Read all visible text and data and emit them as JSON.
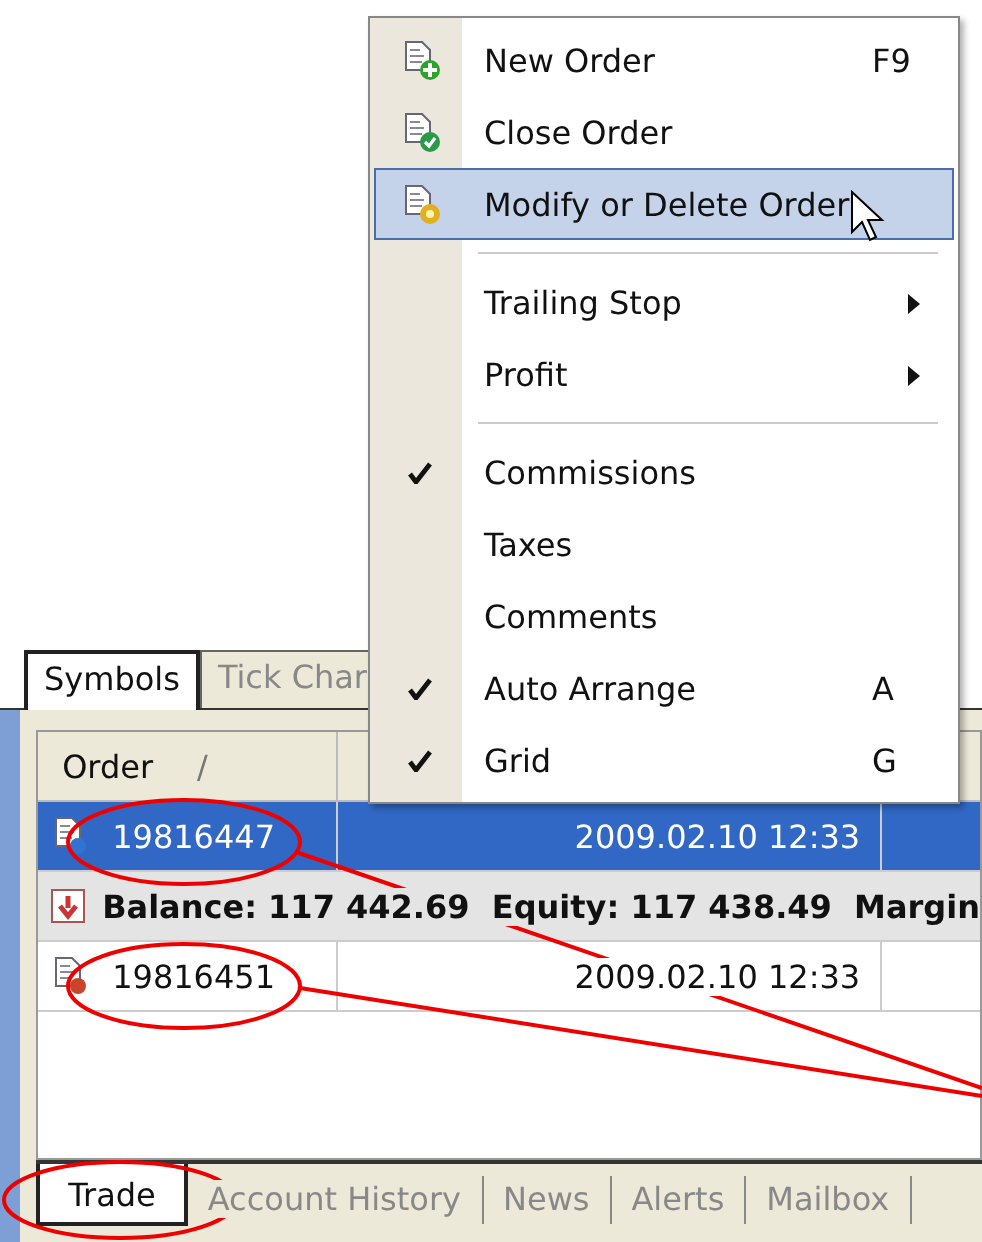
{
  "menu": {
    "items": [
      {
        "kind": "item",
        "label": "New Order",
        "shortcut": "F9",
        "highlighted": false,
        "checked": false,
        "submenu": false
      },
      {
        "kind": "item",
        "label": "Close Order",
        "highlighted": false,
        "checked": false,
        "submenu": false
      },
      {
        "kind": "item",
        "label": "Modify or Delete Order",
        "highlighted": true,
        "checked": false,
        "submenu": false
      },
      {
        "kind": "separator"
      },
      {
        "kind": "item",
        "label": "Trailing Stop",
        "highlighted": false,
        "checked": false,
        "submenu": true
      },
      {
        "kind": "item",
        "label": "Profit",
        "highlighted": false,
        "checked": false,
        "submenu": true
      },
      {
        "kind": "separator"
      },
      {
        "kind": "item",
        "label": "Commissions",
        "highlighted": false,
        "checked": true,
        "submenu": false
      },
      {
        "kind": "item",
        "label": "Taxes",
        "highlighted": false,
        "checked": false,
        "submenu": false
      },
      {
        "kind": "item",
        "label": "Comments",
        "highlighted": false,
        "checked": false,
        "submenu": false
      },
      {
        "kind": "item",
        "label": "Auto Arrange",
        "shortcut": "A",
        "highlighted": false,
        "checked": true,
        "submenu": false
      },
      {
        "kind": "item",
        "label": "Grid",
        "shortcut": "G",
        "highlighted": false,
        "checked": true,
        "submenu": false
      }
    ]
  },
  "top_tabs": [
    {
      "label": "Symbols",
      "selected": true
    },
    {
      "label": "Tick Char",
      "selected": false
    }
  ],
  "table": {
    "columns": [
      {
        "label": "Order",
        "sort_mark": "/"
      }
    ],
    "rows": [
      {
        "kind": "buy",
        "order": "19816447",
        "time": "2009.02.10 12:33",
        "selected": true
      },
      {
        "kind": "summary",
        "text": "Balance: 117 442.69  Equity: 117 438.49  Margin"
      },
      {
        "kind": "sell",
        "order": "19816451",
        "time": "2009.02.10 12:33",
        "selected": false
      }
    ]
  },
  "bottom_tabs": [
    {
      "label": "Trade",
      "selected": true
    },
    {
      "label": "Account History",
      "selected": false
    },
    {
      "label": "News",
      "selected": false
    },
    {
      "label": "Alerts",
      "selected": false
    },
    {
      "label": "Mailbox",
      "selected": false
    }
  ]
}
